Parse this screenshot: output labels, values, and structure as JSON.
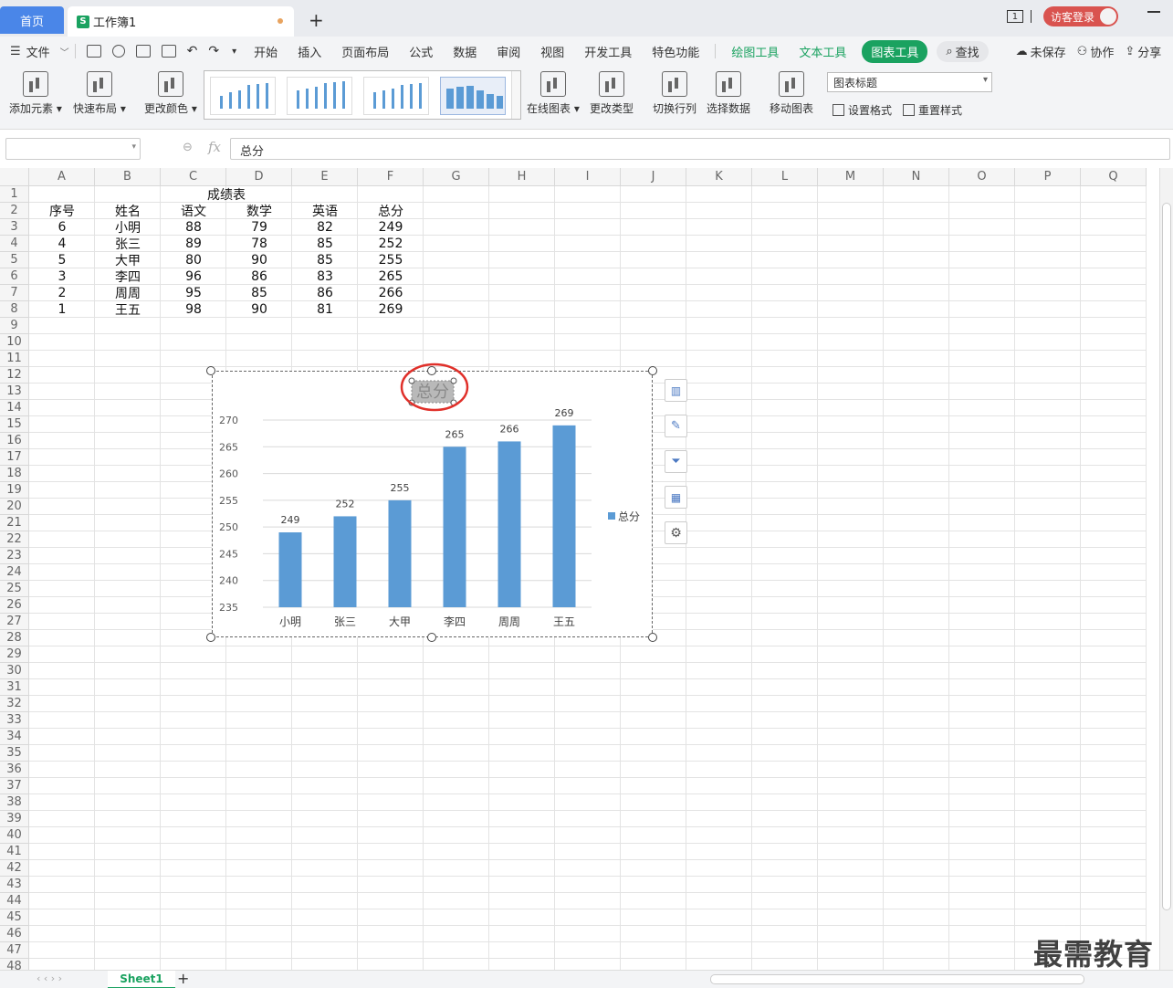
{
  "tabs": {
    "home": "首页",
    "workbook": "工作簿1"
  },
  "account": {
    "page_badge": "1",
    "login": "访客登录"
  },
  "menu": {
    "file": "文件",
    "items": [
      "开始",
      "插入",
      "页面布局",
      "公式",
      "数据",
      "审阅",
      "视图",
      "开发工具",
      "特色功能"
    ],
    "context": [
      "绘图工具",
      "文本工具"
    ],
    "active": "图表工具",
    "search": "查找",
    "right": [
      "未保存",
      "协作",
      "分享"
    ]
  },
  "ribbon": {
    "add_element": "添加元素",
    "quick_layout": "快速布局",
    "change_color": "更改颜色",
    "online_chart": "在线图表",
    "change_type": "更改类型",
    "switch_row_col": "切换行列",
    "select_data": "选择数据",
    "move_chart": "移动图表",
    "element_select": "图表标题",
    "set_format": "设置格式",
    "reset_style": "重置样式"
  },
  "formula": {
    "content": "总分"
  },
  "columns": [
    "A",
    "B",
    "C",
    "D",
    "E",
    "F",
    "G",
    "H",
    "I",
    "J",
    "K",
    "L",
    "M",
    "N",
    "O",
    "P",
    "Q"
  ],
  "sheet": {
    "title": "成绩表",
    "headers": [
      "序号",
      "姓名",
      "语文",
      "数学",
      "英语",
      "总分"
    ],
    "rows": [
      [
        "6",
        "小明",
        "88",
        "79",
        "82",
        "249"
      ],
      [
        "4",
        "张三",
        "89",
        "78",
        "85",
        "252"
      ],
      [
        "5",
        "大甲",
        "80",
        "90",
        "85",
        "255"
      ],
      [
        "3",
        "李四",
        "96",
        "86",
        "83",
        "265"
      ],
      [
        "2",
        "周周",
        "95",
        "85",
        "86",
        "266"
      ],
      [
        "1",
        "王五",
        "98",
        "90",
        "81",
        "269"
      ]
    ]
  },
  "sheet_tab": "Sheet1",
  "watermark": "最需教育",
  "colors": {
    "accent_green": "#1aa260",
    "bar": "#5b9bd5",
    "login": "#d9534f",
    "highlight_ring": "#e0302a"
  },
  "chart_data": {
    "type": "bar",
    "title": "总分",
    "categories": [
      "小明",
      "张三",
      "大甲",
      "李四",
      "周周",
      "王五"
    ],
    "series": [
      {
        "name": "总分",
        "values": [
          249,
          252,
          255,
          265,
          266,
          269
        ]
      }
    ],
    "ylim": [
      235,
      270
    ],
    "yticks": [
      235,
      240,
      245,
      250,
      255,
      260,
      265,
      270
    ],
    "data_labels": true,
    "grid": true,
    "legend": "right"
  }
}
